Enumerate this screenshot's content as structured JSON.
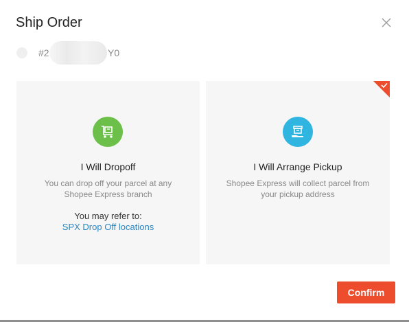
{
  "dialog": {
    "title": "Ship Order",
    "close_icon": "close-icon"
  },
  "order": {
    "id_prefix": "#2",
    "id_suffix": "Y0"
  },
  "options": {
    "dropoff": {
      "icon": "cart-dolly-icon",
      "accent": "#6cc04a",
      "title": "I Will Dropoff",
      "description": "You can drop off your parcel at any Shopee Express branch",
      "refer_label": "You may refer to:",
      "refer_link": "SPX Drop Off locations",
      "link_color": "#2b86c5"
    },
    "pickup": {
      "icon": "box-hand-icon",
      "accent": "#2fb5e0",
      "title": "I Will Arrange Pickup",
      "description": "Shopee Express will collect parcel from your pickup address",
      "selected": true
    }
  },
  "footer": {
    "confirm_label": "Confirm",
    "confirm_color": "#ee4d2d"
  },
  "colors": {
    "brand": "#ee4d2d",
    "card_background": "#f6f6f6"
  }
}
